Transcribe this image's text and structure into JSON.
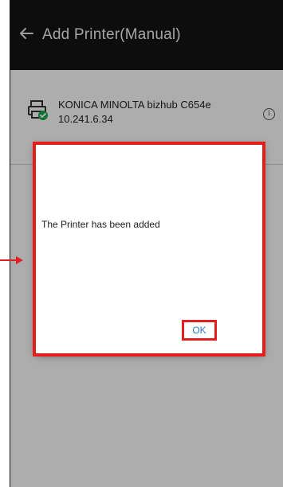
{
  "appbar": {
    "title": "Add Printer(Manual)"
  },
  "printer": {
    "name": "KONICA MINOLTA bizhub C654e",
    "ip": "10.241.6.34"
  },
  "dialog": {
    "message": "The Printer has been added",
    "ok_label": "OK"
  },
  "colors": {
    "appbar_bg": "#141414",
    "highlight": "#e41d1d",
    "ok_text": "#2b7cc4",
    "status_check": "#1aa84a"
  },
  "icons": {
    "back": "arrow-left-icon",
    "printer": "printer-icon",
    "status": "check-badge-icon",
    "info": "info-icon"
  }
}
